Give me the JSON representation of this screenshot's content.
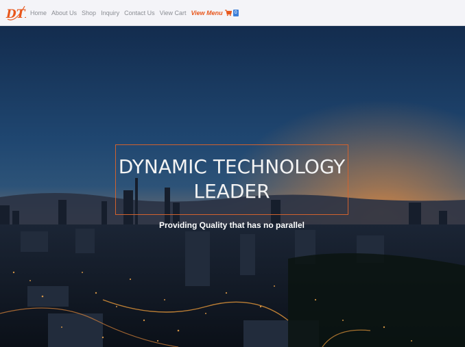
{
  "brand": {
    "logo_text": "DTL",
    "accent_color": "#e8571c"
  },
  "nav": {
    "items": [
      {
        "label": "Home"
      },
      {
        "label": "About Us"
      },
      {
        "label": "Shop"
      },
      {
        "label": "Inquiry"
      },
      {
        "label": "Contact Us"
      },
      {
        "label": "View Cart"
      }
    ],
    "menu_label": "View Menu",
    "cart_icon": "shopping-cart-icon",
    "cart_count": "0"
  },
  "hero": {
    "headline": "DYNAMIC TECHNOLOGY LEADER",
    "tagline": "Providing Quality that has no parallel",
    "frame_color": "#d2622e"
  }
}
